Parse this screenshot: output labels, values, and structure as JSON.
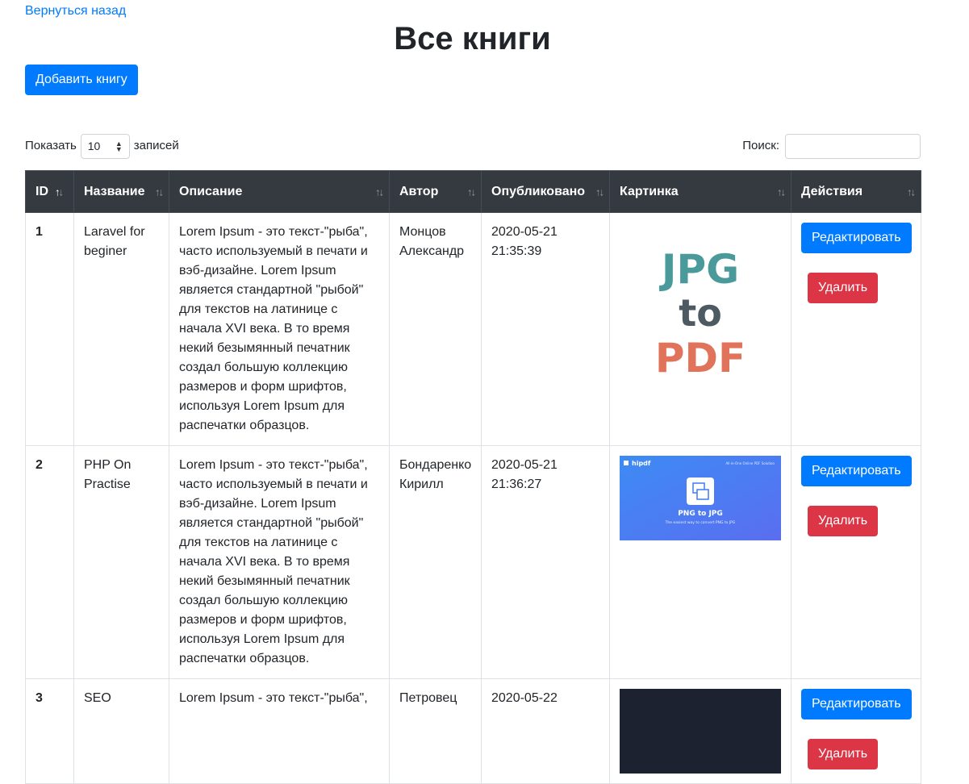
{
  "nav": {
    "back_label": "Вернуться назад"
  },
  "page": {
    "title": "Все книги",
    "add_button": "Добавить книгу"
  },
  "table_controls": {
    "show_label": "Показать",
    "page_size": "10",
    "entries_label": "записей",
    "search_label": "Поиск:",
    "search_value": ""
  },
  "columns": [
    "ID",
    "Название",
    "Описание",
    "Автор",
    "Опубликовано",
    "Картинка",
    "Действия"
  ],
  "rows": [
    {
      "id": "1",
      "title": "Laravel for beginer",
      "description": "Lorem Ipsum - это текст-\"рыба\", часто используемый в печати и вэб-дизайне. Lorem Ipsum является стандартной \"рыбой\" для текстов на латинице с начала XVI века. В то время некий безымянный печатник создал большую коллекцию размеров и форм шрифтов, используя Lorem Ipsum для распечатки образцов.",
      "author": "Монцов Александр",
      "published": "2020-05-21 21:35:39",
      "image": {
        "line1": "JPG",
        "line2": "to",
        "line3": "PDF"
      },
      "edit_label": "Редактировать",
      "delete_label": "Удалить"
    },
    {
      "id": "2",
      "title": "PHP On Practise",
      "description": "Lorem Ipsum - это текст-\"рыба\", часто используемый в печати и вэб-дизайне. Lorem Ipsum является стандартной \"рыбой\" для текстов на латинице с начала XVI века. В то время некий безымянный печатник создал большую коллекцию размеров и форм шрифтов, используя Lorem Ipsum для распечатки образцов.",
      "author": "Бондаренко Кирилл",
      "published": "2020-05-21 21:36:27",
      "image": {
        "brand": "hipdf",
        "heading": "PNG to JPG",
        "subtitle": "The easiest way to convert PNG to JPG",
        "tagline": "All-in-One Online PDF Solution"
      },
      "edit_label": "Редактировать",
      "delete_label": "Удалить"
    },
    {
      "id": "3",
      "title": "SEO",
      "description": "Lorem Ipsum - это текст-\"рыба\",",
      "author": "Петровец",
      "published": "2020-05-22",
      "image": {},
      "edit_label": "Редактировать",
      "delete_label": "Удалить"
    }
  ],
  "colors": {
    "primary": "#007bff",
    "danger": "#dc3545",
    "header_bg": "#343a40",
    "jpg_teal": "#4a9a9c",
    "to_slate": "#4d5a62",
    "pdf_coral": "#e0735a",
    "hipdf_blue": "#3d7cf5"
  }
}
